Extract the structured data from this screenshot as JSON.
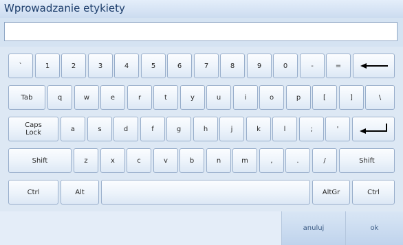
{
  "window": {
    "title": "Wprowadzanie etykiety"
  },
  "input": {
    "value": "",
    "placeholder": ""
  },
  "keyboard": {
    "rows": [
      [
        "`",
        "1",
        "2",
        "3",
        "4",
        "5",
        "6",
        "7",
        "8",
        "9",
        "0",
        "-",
        "=",
        "backspace-icon"
      ],
      [
        "Tab",
        "q",
        "w",
        "e",
        "r",
        "t",
        "y",
        "u",
        "i",
        "o",
        "p",
        "[",
        "]",
        "\\"
      ],
      [
        "Caps\nLock",
        "a",
        "s",
        "d",
        "f",
        "g",
        "h",
        "j",
        "k",
        "l",
        ";",
        "'",
        "enter-icon"
      ],
      [
        "Shift",
        "z",
        "x",
        "c",
        "v",
        "b",
        "n",
        "m",
        ",",
        ".",
        "/",
        "Shift"
      ],
      [
        "Ctrl",
        "Alt",
        "",
        "AltGr",
        "Ctrl"
      ]
    ]
  },
  "buttons": {
    "cancel_label": "anuluj",
    "ok_label": "ok"
  }
}
